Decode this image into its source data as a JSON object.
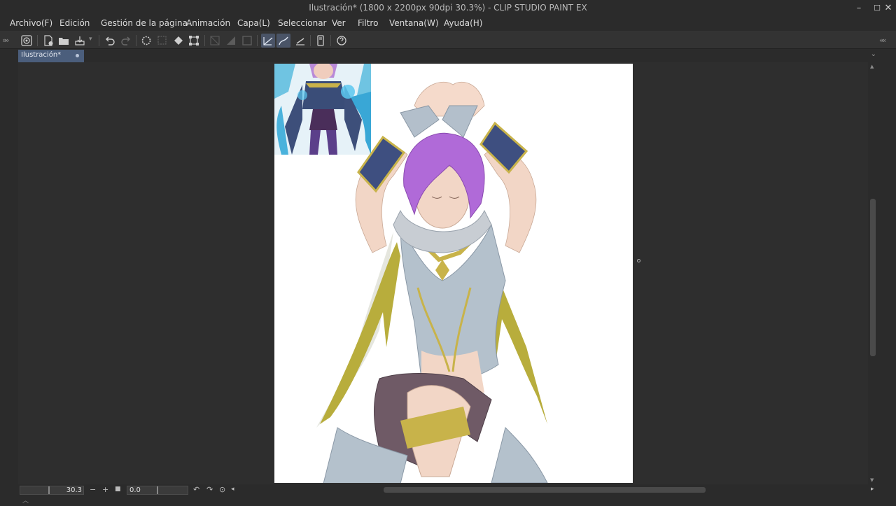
{
  "window": {
    "title": "Ilustración* (1800 x 2200px 90dpi 30.3%)  - CLIP STUDIO PAINT EX",
    "minimize": "–",
    "maximize": "☐",
    "close": "✕"
  },
  "menu": [
    "Archivo(F)",
    "Edición",
    "Gestión de la página",
    "Animación",
    "Capa(L)",
    "Seleccionar",
    "Ver",
    "Filtro",
    "Ventana(W)",
    "Ayuda(H)"
  ],
  "tab": {
    "label": "Ilustración*"
  },
  "toolbar": {
    "icons": [
      "clip-studio-icon",
      "new-file-icon",
      "open-folder-icon",
      "save-icon",
      "undo-icon",
      "redo-icon",
      "loading-icon",
      "select-icon",
      "fill-icon",
      "transform-icon",
      "ruler-icon",
      "gradient-icon",
      "frame-icon",
      "line-correction-icon",
      "curve-icon",
      "stroke-icon",
      "device-icon",
      "help-icon"
    ]
  },
  "navigator": {
    "zoom_value": "30.3",
    "rotate_value": "0.0"
  },
  "colors": {
    "background": "#2b2b2b",
    "tab_active": "#4b5e7c",
    "canvas": "#ffffff"
  }
}
